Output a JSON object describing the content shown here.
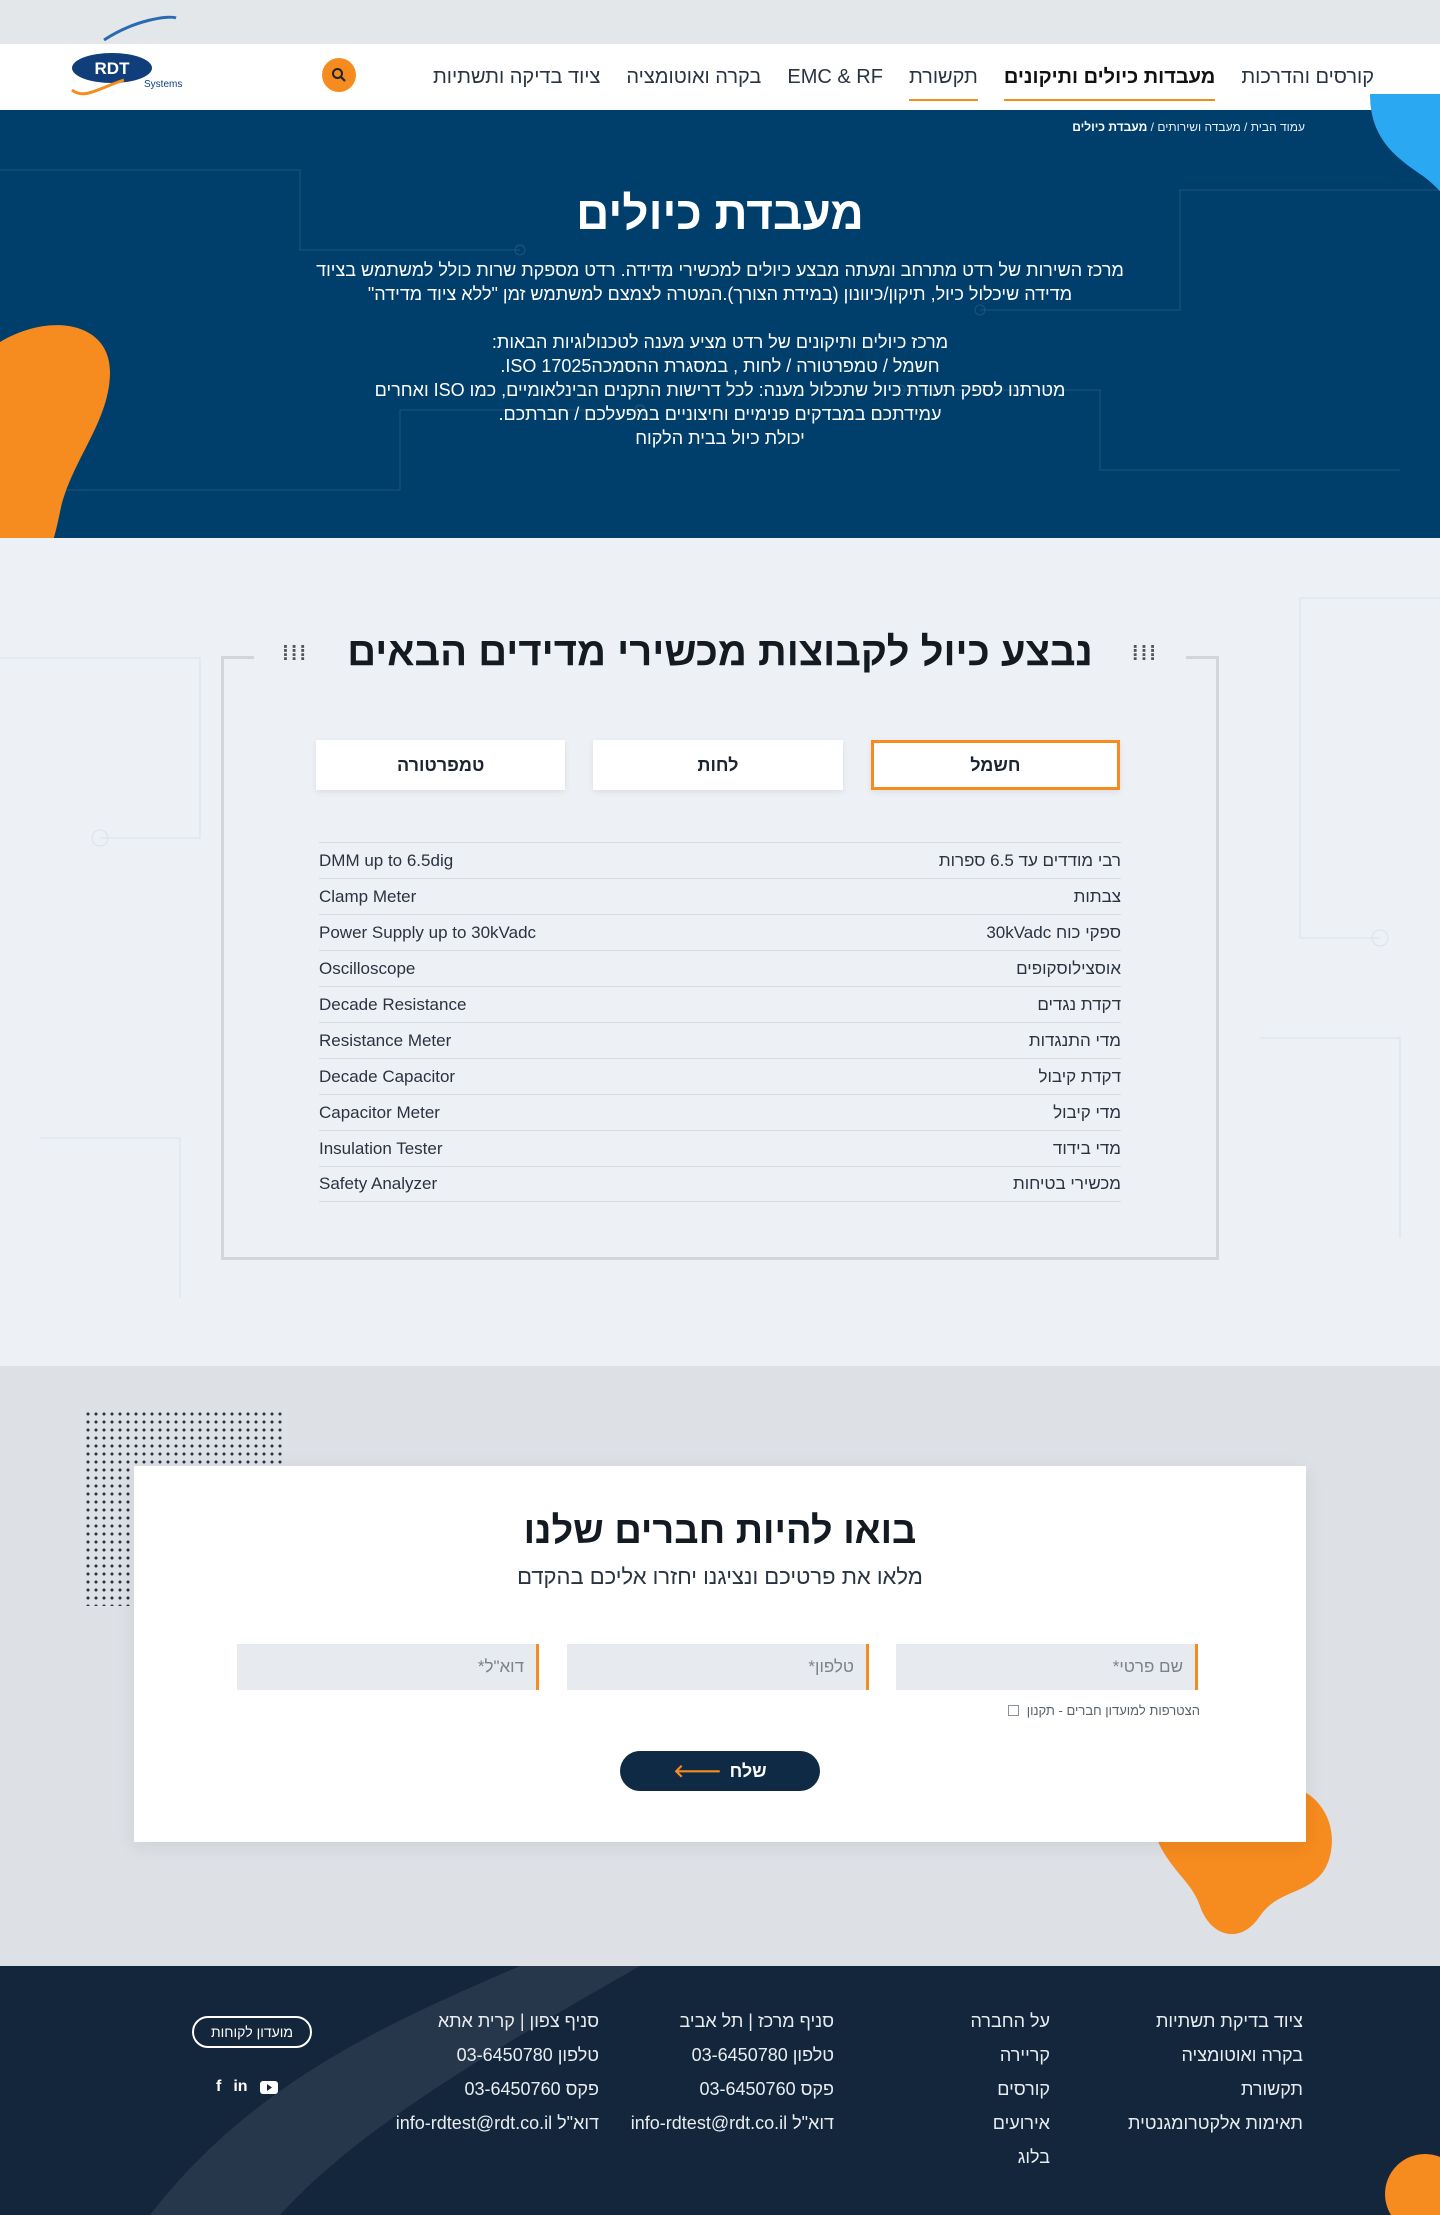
{
  "header": {
    "logo_text": "RDT",
    "logo_sub": "Systems",
    "nav": [
      {
        "label": "ציוד בדיקה ותשתיות"
      },
      {
        "label": "בקרה ואוטומציה"
      },
      {
        "label": "EMC & RF"
      },
      {
        "label": "תקשורת"
      },
      {
        "label": "מעבדות כיולים ותיקונים"
      },
      {
        "label": "קורסים והדרכות"
      }
    ]
  },
  "hero": {
    "breadcrumb_home": "עמוד הבית",
    "breadcrumb_mid": "מעבדה ושירותים",
    "breadcrumb_current": "מעבדת כיולים",
    "title": "מעבדת כיולים",
    "para1_line1": "מרכז השירות של רדט מתרחב ומעתה מבצע כיולים למכשירי מדידה. רדט מספקת שרות כולל למשתמש בציוד",
    "para1_line2": "מדידה שיכלול כיול, תיקון/כיוונון (במידת הצורך).המטרה לצמצם למשתמש זמן \"ללא ציוד מדידה\"",
    "para2_line1": "מרכז כיולים ותיקונים של רדט מציע מענה לטכנולוגיות הבאות:",
    "para2_line2": "חשמל / טמפרטורה / לחות , במסגרת ההסמכהISO 17025.",
    "para2_line3": "מטרתנו לספק תעודת כיול שתכלול מענה: לכל דרישות התקנים הבינלאומיים, כמו ISO ואחרים",
    "para2_line4": "עמידתכם במבדקים פנימיים וחיצוניים במפעלכם / חברתכם.",
    "para2_line5": "יכולת כיול בבית הלקוח"
  },
  "calibration": {
    "title": "נבצע כיול לקבוצות מכשירי מדידים הבאים",
    "tabs": [
      {
        "label": "חשמל"
      },
      {
        "label": "לחות"
      },
      {
        "label": "טמפרטורה"
      }
    ],
    "rows": [
      {
        "he": "רבי מודדים עד 6.5 ספרות",
        "en": "DMM up to 6.5dig"
      },
      {
        "he": "צבתות",
        "en": "Clamp Meter"
      },
      {
        "he": "ספקי כוח 30kVadc",
        "en": "Power Supply up to 30kVadc"
      },
      {
        "he": "אוסצילוסקופים",
        "en": "Oscilloscope"
      },
      {
        "he": "דקדת נגדים",
        "en": "Decade Resistance"
      },
      {
        "he": "מדי התנגדות",
        "en": "Resistance Meter"
      },
      {
        "he": "דקדת קיבול",
        "en": "Decade Capacitor"
      },
      {
        "he": "מדי קיבול",
        "en": "Capacitor Meter"
      },
      {
        "he": "מדי בידוד",
        "en": "Insulation Tester"
      },
      {
        "he": "מכשירי בטיחות",
        "en": "Safety Analyzer"
      }
    ]
  },
  "join": {
    "title": "בואו להיות חברים שלנו",
    "subtitle": "מלאו את פרטיכם ונציגנו יחזרו אליכם בהקדם",
    "name_placeholder": "שם פרטי*",
    "phone_placeholder": "טלפון*",
    "email_placeholder": "דוא\"ל*",
    "consent_label": "הצטרפות למועדון חברים - תקנון",
    "send_label": "שלח"
  },
  "footer": {
    "col1": [
      "ציוד בדיקת תשתיות",
      "בקרה ואוטומציה",
      "תקשורת",
      "תאימות אלקטרומגנטית"
    ],
    "col2": [
      "על החברה",
      "קריירה",
      "קורסים",
      "אירועים",
      "בלוג"
    ],
    "col3": [
      "סניף מרכז | תל אביב",
      "טלפון 03-6450780",
      "פקס 03-6450760",
      "דוא\"ל info-rdtest@rdt.co.il"
    ],
    "col4": [
      "סניף צפון | קרית אתא",
      "טלפון 03-6450780",
      "פקס 03-6450760",
      "דוא\"ל info-rdtest@rdt.co.il"
    ],
    "club_label": "מועדון לקוחות",
    "social_icons": [
      "facebook-icon",
      "linkedin-icon",
      "youtube-icon"
    ]
  },
  "colors": {
    "brand_navy": "#003e6b",
    "accent_orange": "#f68b1f",
    "accent_blue": "#2aa8f2",
    "footer_bg": "#14263c"
  }
}
